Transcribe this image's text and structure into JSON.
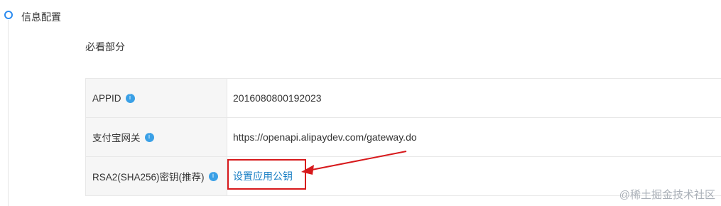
{
  "section": {
    "title": "信息配置"
  },
  "subsection": {
    "title": "必看部分"
  },
  "rows": [
    {
      "label": "APPID",
      "value": "2016080800192023"
    },
    {
      "label": "支付宝网关",
      "value": "https://openapi.alipaydev.com/gateway.do"
    },
    {
      "label": "RSA2(SHA256)密钥(推荐)",
      "link": "设置应用公钥"
    }
  ],
  "info_icon_glyph": "i",
  "watermark": "@稀土掘金技术社区",
  "colors": {
    "accent": "#2d8cf0",
    "link": "#1a7fc4",
    "annotation": "#d7191c"
  },
  "icons": [
    "timeline-dot-icon",
    "info-icon",
    "annotation-arrow-icon"
  ]
}
